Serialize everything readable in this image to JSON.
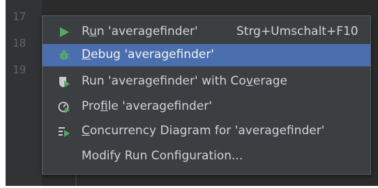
{
  "gutter": {
    "line_numbers": [
      "17",
      "18",
      "19"
    ]
  },
  "menu": {
    "items": [
      {
        "label_pre": "R",
        "label_mnemonic": "u",
        "label_post": "n 'averagefinder'",
        "shortcut": "Strg+Umschalt+F10",
        "icon": "run-play-icon",
        "selected": false
      },
      {
        "label_pre": "",
        "label_mnemonic": "D",
        "label_post": "ebug 'averagefinder'",
        "shortcut": "",
        "icon": "debug-bug-icon",
        "selected": true
      },
      {
        "label_pre": "Run 'averagefinder' with Co",
        "label_mnemonic": "v",
        "label_post": "erage",
        "shortcut": "",
        "icon": "coverage-shield-icon",
        "selected": false
      },
      {
        "label_pre": "Pro",
        "label_mnemonic": "f",
        "label_post": "ile 'averagefinder'",
        "shortcut": "",
        "icon": "profile-gauge-icon",
        "selected": false
      },
      {
        "label_pre": "",
        "label_mnemonic": "C",
        "label_post": "oncurrency Diagram for 'averagefinder'",
        "shortcut": "",
        "icon": "concurrency-diagram-icon",
        "selected": false
      },
      {
        "label_pre": "Modify Run Configuration...",
        "label_mnemonic": "",
        "label_post": "",
        "shortcut": "",
        "icon": "",
        "selected": false
      }
    ]
  },
  "colors": {
    "editor_background": "#2b2b2b",
    "popup_background": "#3c3f41",
    "selection": "#4b6eaf",
    "run_green": "#59a869",
    "text": "#cfd2d6"
  }
}
